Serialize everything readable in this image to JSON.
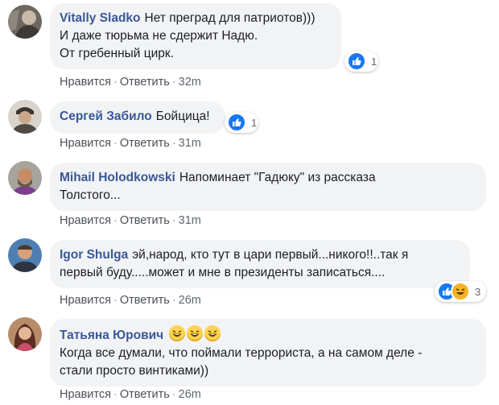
{
  "comments": [
    {
      "author": "Vitally Sladko",
      "lines": [
        "Нет преград для патриотов)))",
        "И даже тюрьма не сдержит Надю.",
        "От гребенный цирк."
      ],
      "reaction_count": "1",
      "actions": {
        "like": "Нравится",
        "reply": "Ответить",
        "time": "32m"
      }
    },
    {
      "author": "Сергей Забило",
      "lines": [
        "Бойцица!"
      ],
      "reaction_count": "1",
      "actions": {
        "like": "Нравится",
        "reply": "Ответить",
        "time": "31m"
      }
    },
    {
      "author": "Mihail Holodkowski",
      "lines": [
        "Напоминает \"Гадюку\" из рассказа",
        "Толстого..."
      ],
      "actions": {
        "like": "Нравится",
        "reply": "Ответить",
        "time": "31m"
      }
    },
    {
      "author": "Igor Shulga",
      "lines": [
        "эй,народ, кто тут в цари первый...никого!!..так я",
        "первый буду.....может и мне в президенты записаться...."
      ],
      "reaction_count": "3",
      "actions": {
        "like": "Нравится",
        "reply": "Ответить",
        "time": "26m"
      }
    },
    {
      "author": "Татьяна Юрович",
      "lines": [
        "Когда все думали, что поймали террориста, а на самом деле -",
        "стали просто винтиками))"
      ],
      "emoji_count": 3,
      "actions": {
        "like": "Нравится",
        "reply": "Ответить",
        "time": "26m"
      }
    }
  ],
  "separator": "·",
  "colors": {
    "bubble_bg": "#f2f3f5",
    "author": "#385898",
    "meta": "#606770",
    "like_blue": "#1877f2",
    "haha_yellow": "#f7b125"
  }
}
